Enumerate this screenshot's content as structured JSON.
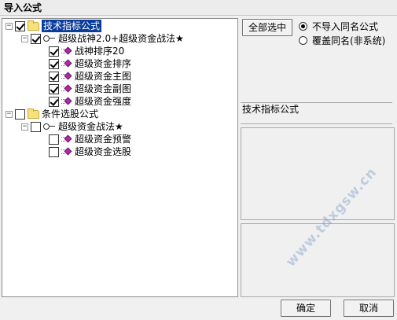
{
  "window": {
    "title": "导入公式"
  },
  "tree": {
    "groups": [
      {
        "label": "技术指标公式",
        "expander": "−",
        "checked": true,
        "selected": true,
        "children": [
          {
            "label": "超级战神2.0+超级资金战法★",
            "expander": "−",
            "checked": true,
            "children": [
              {
                "label": "战神排序20",
                "checked": true
              },
              {
                "label": "超级资金排序",
                "checked": true
              },
              {
                "label": "超级资金主图",
                "checked": true
              },
              {
                "label": "超级资金副图",
                "checked": true
              },
              {
                "label": "超级资金强度",
                "checked": true
              }
            ]
          }
        ]
      },
      {
        "label": "条件选股公式",
        "expander": "−",
        "checked": false,
        "children": [
          {
            "label": "超级资金战法★",
            "expander": "−",
            "checked": false,
            "children": [
              {
                "label": "超级资金预警",
                "checked": false
              },
              {
                "label": "超级资金选股",
                "checked": false
              }
            ]
          }
        ]
      }
    ]
  },
  "options": {
    "select_all_label": "全部选中",
    "radio_options": [
      {
        "label": "不导入同名公式",
        "selected": true
      },
      {
        "label": "覆盖同名(非系统)",
        "selected": false
      }
    ]
  },
  "description": {
    "label": "技术指标公式"
  },
  "footer": {
    "ok_label": "确定",
    "cancel_label": "取消"
  },
  "watermark": "www.tdxgsw.cn"
}
